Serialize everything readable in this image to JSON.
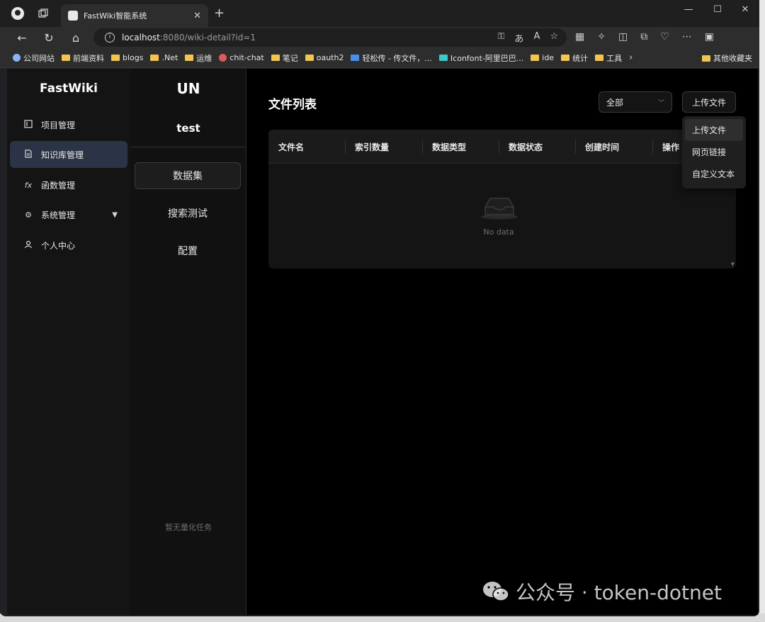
{
  "browser": {
    "tab_title": "FastWiki智能系统",
    "url_host": "localhost",
    "url_rest": ":8080/wiki-detail?id=1",
    "bookmarks": [
      {
        "label": "公司网站",
        "icon": "globe-icon"
      },
      {
        "label": "前端资料",
        "icon": "folder-icon"
      },
      {
        "label": "blogs",
        "icon": "folder-icon"
      },
      {
        "label": ".Net",
        "icon": "folder-icon"
      },
      {
        "label": "运维",
        "icon": "folder-icon"
      },
      {
        "label": "chit-chat",
        "icon": "chat-icon"
      },
      {
        "label": "笔记",
        "icon": "folder-icon"
      },
      {
        "label": "oauth2",
        "icon": "folder-icon"
      },
      {
        "label": "轻松传 - 传文件，...",
        "icon": "upload-cloud-icon"
      },
      {
        "label": "Iconfont-阿里巴巴...",
        "icon": "iconfont-icon"
      },
      {
        "label": "ide",
        "icon": "folder-icon"
      },
      {
        "label": "统计",
        "icon": "folder-icon"
      },
      {
        "label": "工具",
        "icon": "folder-icon"
      }
    ],
    "other_bookmarks": "其他收藏夹"
  },
  "sidebar": {
    "logo": "FastWiki",
    "items": [
      {
        "label": "项目管理",
        "icon": "project-icon",
        "active": false
      },
      {
        "label": "知识库管理",
        "icon": "document-icon",
        "active": true
      },
      {
        "label": "函数管理",
        "icon": "function-icon",
        "active": false
      },
      {
        "label": "系统管理",
        "icon": "gear-icon",
        "active": false,
        "expandable": true
      },
      {
        "label": "个人中心",
        "icon": "user-icon",
        "active": false
      }
    ]
  },
  "wiki": {
    "avatar_text": "UN",
    "name": "test",
    "tabs": [
      "数据集",
      "搜索测试",
      "配置"
    ],
    "active_tab": "数据集",
    "empty_tasks": "暂无量化任务"
  },
  "main": {
    "title": "文件列表",
    "filter_value": "全部",
    "upload_label": "上传文件",
    "columns": [
      "文件名",
      "索引数量",
      "数据类型",
      "数据状态",
      "创建时间",
      "操作"
    ],
    "empty_text": "No data",
    "dropdown": [
      "上传文件",
      "网页链接",
      "自定义文本"
    ]
  },
  "watermark": "公众号 · token-dotnet"
}
